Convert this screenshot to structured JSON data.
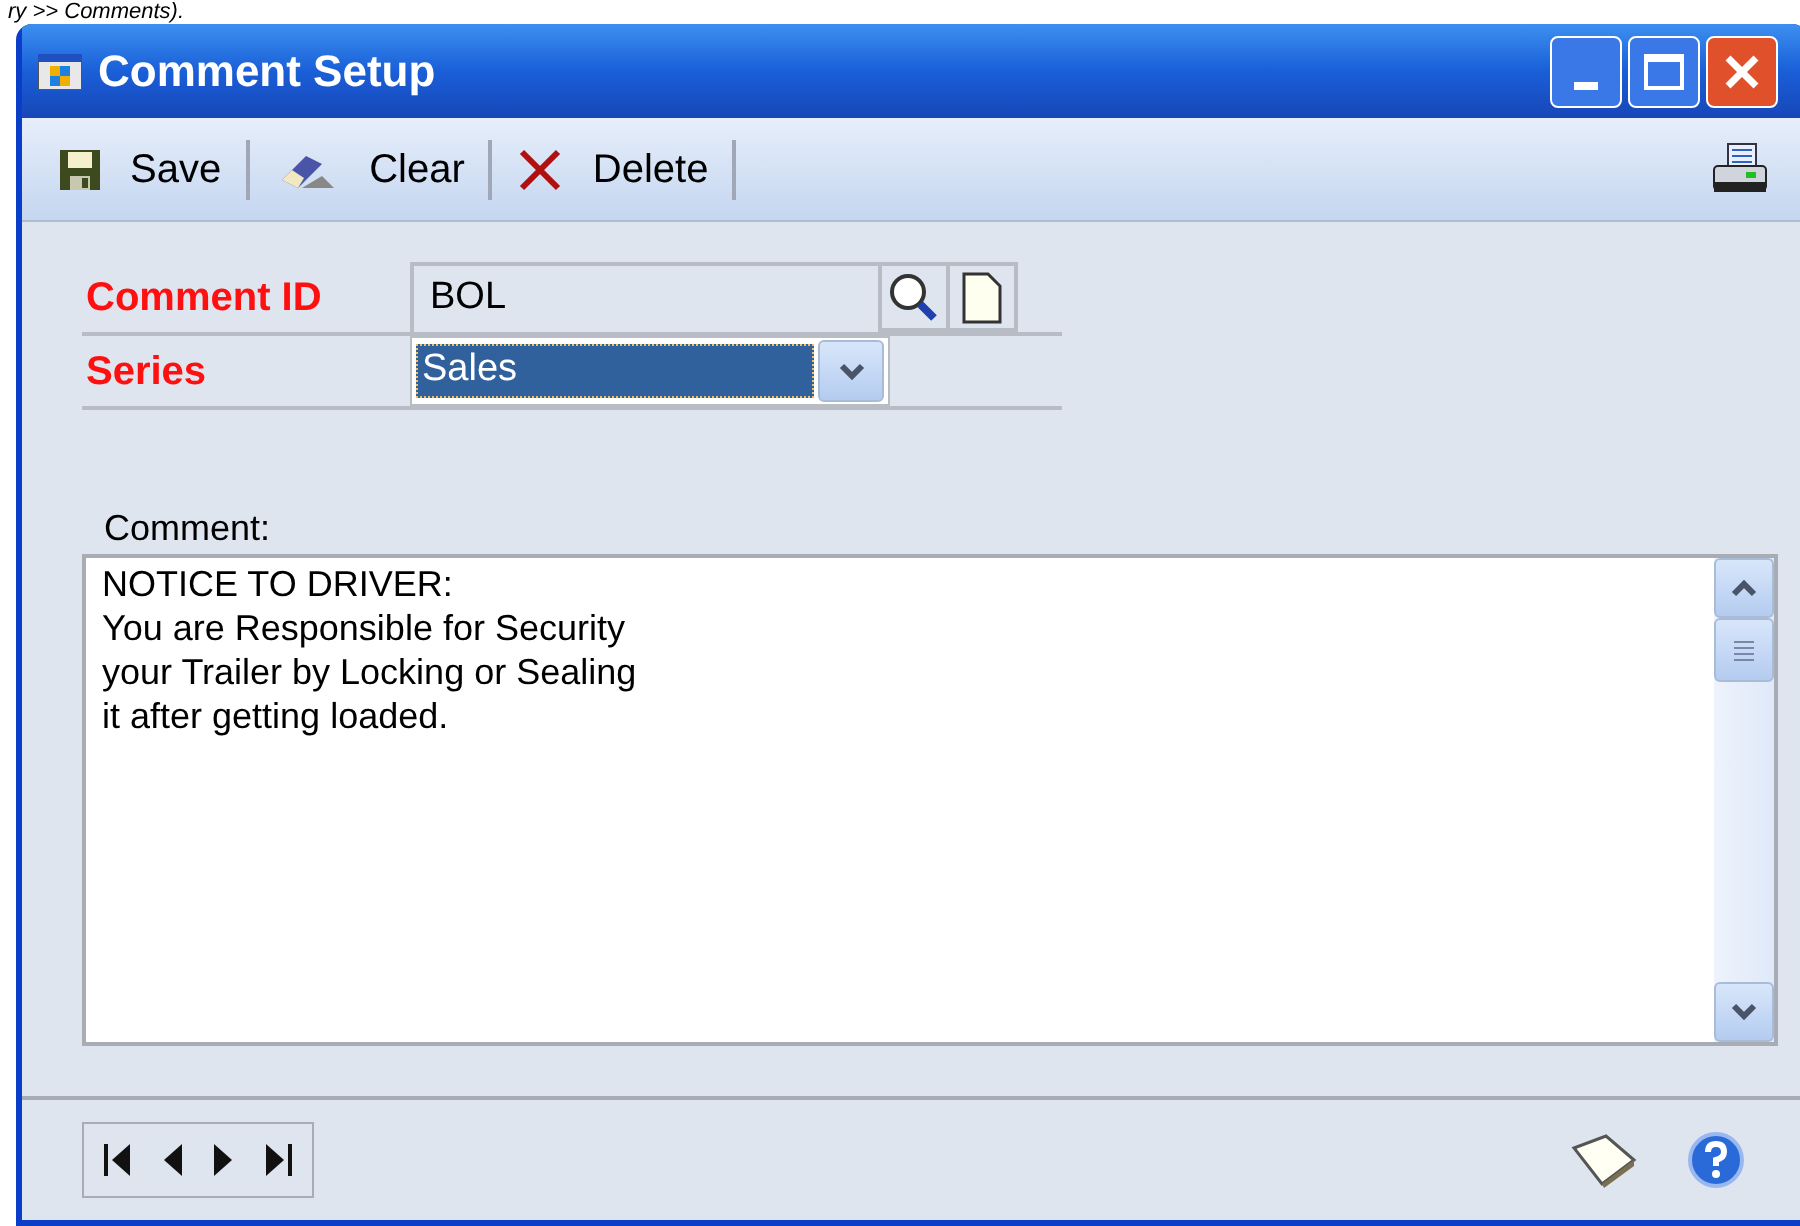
{
  "caption": "ry >> Comments).",
  "window": {
    "title": "Comment Setup"
  },
  "toolbar": [
    {
      "kind": "save",
      "label": "Save"
    },
    {
      "kind": "clear",
      "label": "Clear"
    },
    {
      "kind": "delete",
      "label": "Delete"
    }
  ],
  "fields": [
    {
      "kind": "lookup",
      "label": "Comment ID",
      "value": "BOL",
      "required": true
    },
    {
      "kind": "dropdown",
      "label": "Series",
      "value": "Sales",
      "required": true,
      "focused": true
    }
  ],
  "comment": {
    "label": "Comment:",
    "lines": [
      "NOTICE TO DRIVER:",
      "You are Responsible for Security",
      "your Trailer by Locking or Sealing",
      "it after getting loaded."
    ]
  }
}
